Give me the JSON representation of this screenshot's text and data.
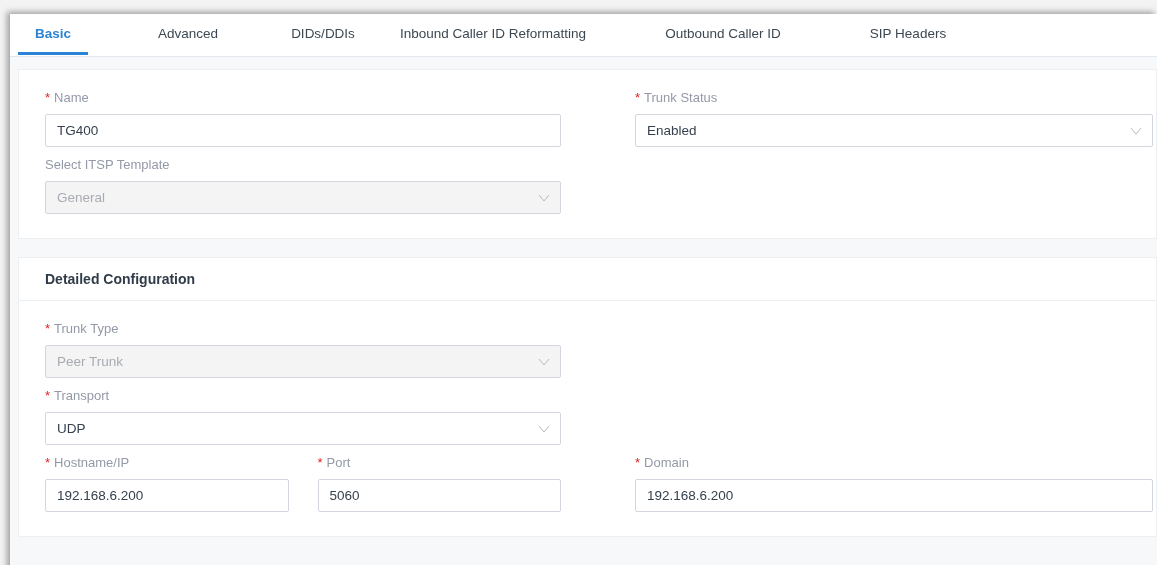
{
  "tabs": [
    {
      "label": "Basic",
      "selected": true
    },
    {
      "label": "Advanced",
      "selected": false
    },
    {
      "label": "DIDs/DDIs",
      "selected": false
    },
    {
      "label": "Inbound Caller ID Reformatting",
      "selected": false
    },
    {
      "label": "Outbound Caller ID",
      "selected": false
    },
    {
      "label": "SIP Headers",
      "selected": false
    }
  ],
  "sections": [
    {
      "rows": [
        {
          "left": [
            {
              "label": "Name",
              "required_mark": "*",
              "kind": "input",
              "value": "TG400",
              "disabled": false
            }
          ],
          "right": [
            {
              "label": "Trunk Status",
              "required_mark": "*",
              "kind": "select",
              "value": "Enabled",
              "disabled": false
            }
          ]
        },
        {
          "left": [
            {
              "label": "Select ITSP Template",
              "kind": "select",
              "value": "General",
              "disabled": true
            }
          ],
          "right": []
        }
      ]
    },
    {
      "title": "Detailed Configuration",
      "rows": [
        {
          "left": [
            {
              "label": "Trunk Type",
              "required_mark": "*",
              "kind": "select",
              "value": "Peer Trunk",
              "disabled": true
            }
          ],
          "right": []
        },
        {
          "left": [
            {
              "label": "Transport",
              "required_mark": "*",
              "kind": "select",
              "value": "UDP",
              "disabled": false
            }
          ],
          "right": []
        },
        {
          "left": [
            {
              "label": "Hostname/IP",
              "required_mark": "*",
              "kind": "input",
              "value": "192.168.6.200",
              "disabled": false
            },
            {
              "label": "Port",
              "required_mark": "*",
              "kind": "input",
              "value": "5060",
              "disabled": false
            }
          ],
          "right": [
            {
              "label": "Domain",
              "required_mark": "*",
              "kind": "input",
              "value": "192.168.6.200",
              "disabled": false
            }
          ]
        }
      ]
    }
  ]
}
